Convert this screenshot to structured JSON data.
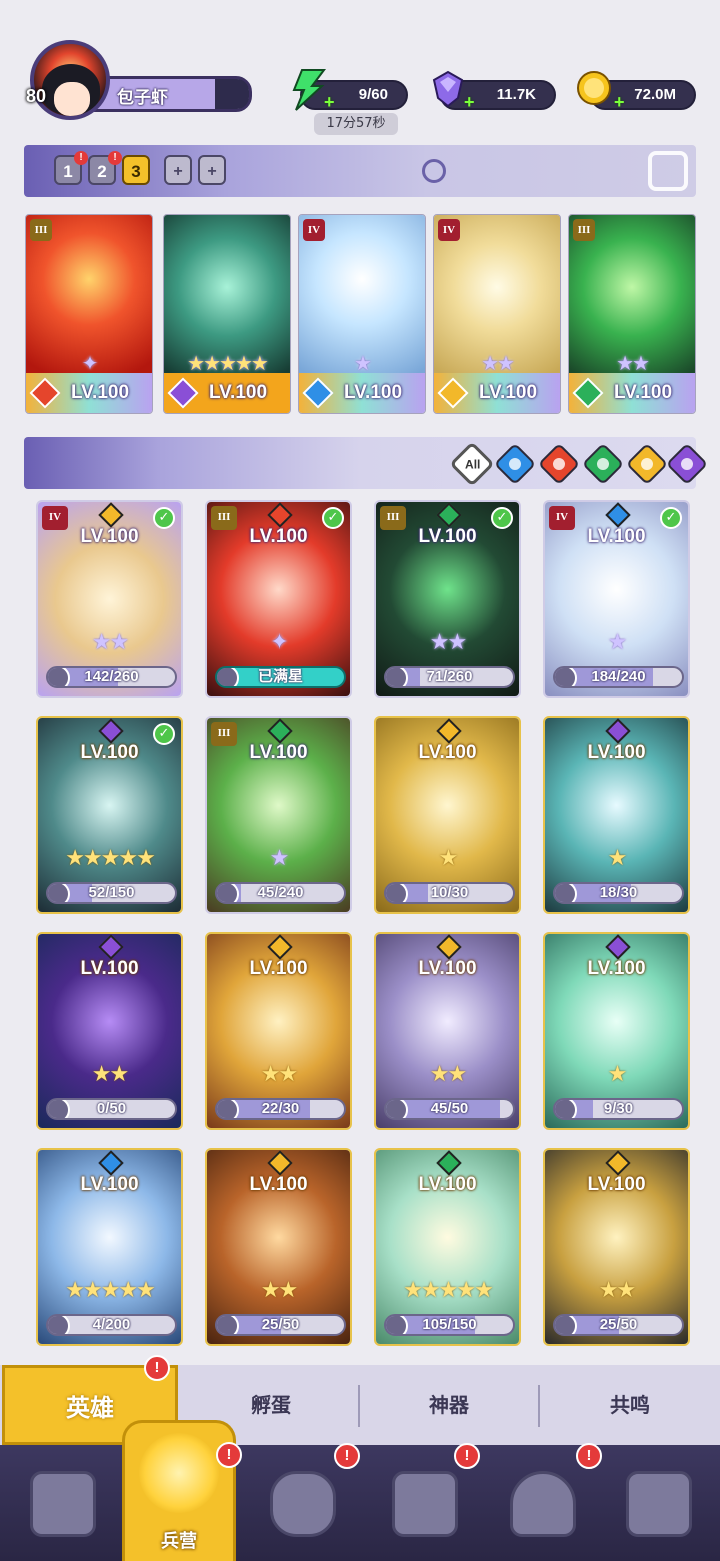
{
  "player": {
    "level": "80",
    "name": "包子虾"
  },
  "resources": {
    "energy": {
      "value": "9/60",
      "timer": "17分57秒"
    },
    "gems": {
      "value": "11.7K"
    },
    "coins": {
      "value": "72.0M"
    }
  },
  "team_tabs": [
    {
      "label": "1",
      "alert": true
    },
    {
      "label": "2",
      "alert": true
    },
    {
      "label": "3",
      "active": true
    },
    {
      "label": "+"
    },
    {
      "label": "+"
    }
  ],
  "deployed": [
    {
      "rank": "III",
      "level": "LV.100",
      "element": "fire",
      "stars": 1,
      "star_type": "winged"
    },
    {
      "rank": "",
      "level": "LV.100",
      "element": "dark",
      "stars": 5,
      "star_type": "gold"
    },
    {
      "rank": "IV",
      "level": "LV.100",
      "element": "water",
      "stars": 1,
      "star_type": "purple"
    },
    {
      "rank": "IV",
      "level": "LV.100",
      "element": "light",
      "stars": 2,
      "star_type": "purple"
    },
    {
      "rank": "III",
      "level": "LV.100",
      "element": "wind",
      "stars": 2,
      "star_type": "purple"
    }
  ],
  "filters": {
    "all_label": "All",
    "elements": [
      "water",
      "fire",
      "wind",
      "light",
      "dark"
    ]
  },
  "heroes": [
    {
      "rank": "IV",
      "level": "LV.100",
      "element": "light",
      "owned": true,
      "stars": 2,
      "progress": "142/260",
      "style": "purple"
    },
    {
      "rank": "III",
      "level": "LV.100",
      "element": "fire",
      "owned": true,
      "stars": 1,
      "progress": "已满星",
      "style": "purple",
      "full": true
    },
    {
      "rank": "III",
      "level": "LV.100",
      "element": "wind",
      "owned": true,
      "stars": 2,
      "progress": "71/260",
      "style": "purple"
    },
    {
      "rank": "IV",
      "level": "LV.100",
      "element": "water",
      "owned": true,
      "stars": 1,
      "progress": "184/240",
      "style": "purple"
    },
    {
      "rank": "",
      "level": "LV.100",
      "element": "dark",
      "owned": true,
      "stars": 5,
      "progress": "52/150",
      "style": "gold"
    },
    {
      "rank": "III",
      "level": "LV.100",
      "element": "wind",
      "owned": false,
      "stars": 1,
      "progress": "45/240",
      "style": "purple"
    },
    {
      "rank": "",
      "level": "LV.100",
      "element": "light",
      "owned": false,
      "stars": 1,
      "progress": "10/30",
      "style": "gold"
    },
    {
      "rank": "",
      "level": "LV.100",
      "element": "dark",
      "owned": false,
      "stars": 1,
      "progress": "18/30",
      "style": "gold"
    },
    {
      "rank": "",
      "level": "LV.100",
      "element": "dark",
      "owned": false,
      "stars": 2,
      "progress": "0/50",
      "style": "gold"
    },
    {
      "rank": "",
      "level": "LV.100",
      "element": "light",
      "owned": false,
      "stars": 2,
      "progress": "22/30",
      "style": "gold"
    },
    {
      "rank": "",
      "level": "LV.100",
      "element": "light",
      "owned": false,
      "stars": 2,
      "progress": "45/50",
      "style": "gold"
    },
    {
      "rank": "",
      "level": "LV.100",
      "element": "dark",
      "owned": false,
      "stars": 1,
      "progress": "9/30",
      "style": "gold"
    },
    {
      "rank": "",
      "level": "LV.100",
      "element": "water",
      "owned": false,
      "stars": 5,
      "progress": "4/200",
      "style": "gold"
    },
    {
      "rank": "",
      "level": "LV.100",
      "element": "light",
      "owned": false,
      "stars": 2,
      "progress": "25/50",
      "style": "gold"
    },
    {
      "rank": "",
      "level": "LV.100",
      "element": "wind",
      "owned": false,
      "stars": 5,
      "progress": "105/150",
      "style": "gold"
    },
    {
      "rank": "",
      "level": "LV.100",
      "element": "light",
      "owned": false,
      "stars": 2,
      "progress": "25/50",
      "style": "gold"
    }
  ],
  "subtabs": [
    {
      "label": "英雄",
      "active": true,
      "alert": true
    },
    {
      "label": "孵蛋"
    },
    {
      "label": "神器"
    },
    {
      "label": "共鸣"
    }
  ],
  "nav": {
    "active_label": "兵营"
  },
  "colors": {
    "fire": "#e5452c",
    "water": "#2f8fe6",
    "wind": "#2bb05a",
    "light": "#f2b82a",
    "dark": "#8a4fd6",
    "accent": "#f4c12a",
    "bar": "#34304e"
  }
}
